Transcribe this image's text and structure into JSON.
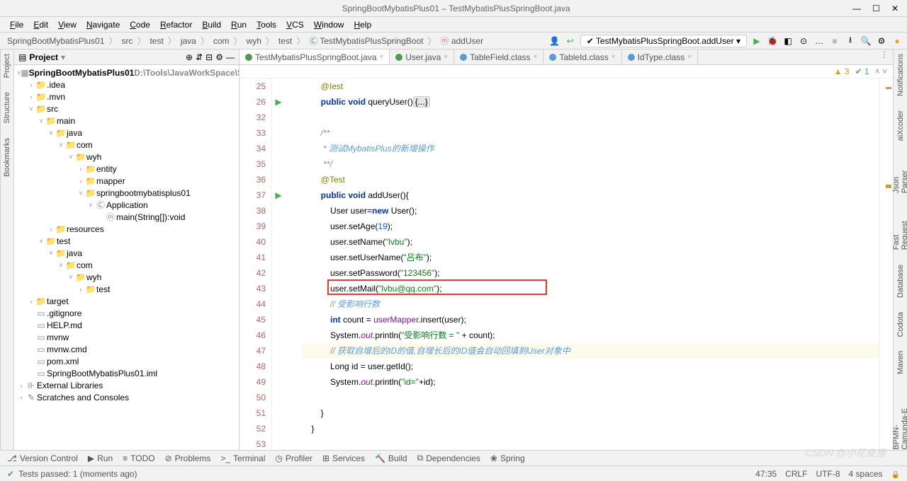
{
  "title": "SpringBootMybatisPlus01 – TestMybatisPlusSpringBoot.java",
  "menu": [
    "File",
    "Edit",
    "View",
    "Navigate",
    "Code",
    "Refactor",
    "Build",
    "Run",
    "Tools",
    "VCS",
    "Window",
    "Help"
  ],
  "breadcrumb": [
    "SpringBootMybatisPlus01",
    "src",
    "test",
    "java",
    "com",
    "wyh",
    "test",
    "TestMybatisPlusSpringBoot",
    "addUser"
  ],
  "run_config": "TestMybatisPlusSpringBoot.addUser",
  "project_tool": "Project",
  "tree": [
    {
      "d": 0,
      "a": "v",
      "i": "mod",
      "t": "SpringBootMybatisPlus01",
      "suffix": "  D:\\Tools\\JavaWorkSpace\\Sprin",
      "bold": true
    },
    {
      "d": 1,
      "a": ">",
      "i": "fol",
      "t": ".idea"
    },
    {
      "d": 1,
      "a": ">",
      "i": "fol",
      "t": ".mvn"
    },
    {
      "d": 1,
      "a": "v",
      "i": "folb",
      "t": "src"
    },
    {
      "d": 2,
      "a": "v",
      "i": "folb",
      "t": "main"
    },
    {
      "d": 3,
      "a": "v",
      "i": "folb",
      "t": "java"
    },
    {
      "d": 4,
      "a": "v",
      "i": "fol",
      "t": "com"
    },
    {
      "d": 5,
      "a": "v",
      "i": "fol",
      "t": "wyh"
    },
    {
      "d": 6,
      "a": ">",
      "i": "fol",
      "t": "entity"
    },
    {
      "d": 6,
      "a": ">",
      "i": "fol",
      "t": "mapper"
    },
    {
      "d": 6,
      "a": "v",
      "i": "fol",
      "t": "springbootmybatisplus01"
    },
    {
      "d": 7,
      "a": "v",
      "i": "cls",
      "t": "Application"
    },
    {
      "d": 8,
      "a": " ",
      "i": "m",
      "t": "main(String[]):void"
    },
    {
      "d": 3,
      "a": ">",
      "i": "folb",
      "t": "resources"
    },
    {
      "d": 2,
      "a": "v",
      "i": "folb",
      "t": "test"
    },
    {
      "d": 3,
      "a": "v",
      "i": "folb",
      "t": "java"
    },
    {
      "d": 4,
      "a": "v",
      "i": "fol",
      "t": "com"
    },
    {
      "d": 5,
      "a": "v",
      "i": "fol",
      "t": "wyh"
    },
    {
      "d": 6,
      "a": ">",
      "i": "fol",
      "t": "test"
    },
    {
      "d": 1,
      "a": ">",
      "i": "folo",
      "t": "target"
    },
    {
      "d": 1,
      "a": " ",
      "i": "f",
      "t": ".gitignore"
    },
    {
      "d": 1,
      "a": " ",
      "i": "f",
      "t": "HELP.md"
    },
    {
      "d": 1,
      "a": " ",
      "i": "f",
      "t": "mvnw"
    },
    {
      "d": 1,
      "a": " ",
      "i": "f",
      "t": "mvnw.cmd"
    },
    {
      "d": 1,
      "a": " ",
      "i": "f",
      "t": "pom.xml"
    },
    {
      "d": 1,
      "a": " ",
      "i": "f",
      "t": "SpringBootMybatisPlus01.iml"
    },
    {
      "d": 0,
      "a": ">",
      "i": "lib",
      "t": "External Libraries"
    },
    {
      "d": 0,
      "a": ">",
      "i": "scr",
      "t": "Scratches and Consoles"
    }
  ],
  "tabs": [
    {
      "label": "TestMybatisPlusSpringBoot.java",
      "active": true,
      "dot": "c"
    },
    {
      "label": "User.java",
      "dot": "c"
    },
    {
      "label": "TableField.class",
      "dot": "j"
    },
    {
      "label": "TableId.class",
      "dot": "j"
    },
    {
      "label": "IdType.class",
      "dot": "j"
    }
  ],
  "inspection": {
    "warn": "3",
    "ok": "1"
  },
  "code_lines": [
    {
      "n": "25",
      "html": "        <span class='ann'>@Iest</span>"
    },
    {
      "n": "26",
      "mark": "▶",
      "html": "        <span class='kw'>public</span> <span class='kw'>void</span> queryUser()<span class='fold'>{...}</span>"
    },
    {
      "n": "32",
      "html": ""
    },
    {
      "n": "33",
      "html": "        <span class='cmt-doc'>/**</span>"
    },
    {
      "n": "34",
      "html": "        <span class='cmt-doc'> * <span class='zh'>测试MybatisPlus的新增操作</span></span>"
    },
    {
      "n": "35",
      "html": "        <span class='cmt-doc'> **/</span>"
    },
    {
      "n": "36",
      "html": "        <span class='ann'>@Test</span>"
    },
    {
      "n": "37",
      "mark": "▶",
      "html": "        <span class='kw'>public</span> <span class='kw'>void</span> addUser(){"
    },
    {
      "n": "38",
      "html": "            User user=<span class='kw'>new</span> User();"
    },
    {
      "n": "39",
      "html": "            user.setAge(<span class='num'>19</span>);"
    },
    {
      "n": "40",
      "html": "            user.setName(<span class='str'>\"lvbu\"</span>);"
    },
    {
      "n": "41",
      "html": "            user.setUserName(<span class='str'>\"吕布\"</span>);"
    },
    {
      "n": "42",
      "html": "            user.setPassword(<span class='str'>\"123456\"</span>);"
    },
    {
      "n": "43",
      "html": "            user.setMail(<span class='str'>\"lvbu@qq.com\"</span>);"
    },
    {
      "n": "44",
      "html": "            <span class='cmt-line'>// <span class='zh'>受影响行数</span></span>"
    },
    {
      "n": "45",
      "html": "            <span class='kw'>int</span> count = <span class='fld'>userMapper</span>.insert(user);"
    },
    {
      "n": "46",
      "html": "            System.<span class='fld ital'>out</span>.println(<span class='str'>\"受影响行数 = \"</span> + count);"
    },
    {
      "n": "47",
      "hl": true,
      "html": "            <span class='cmt-line'>// <span class='zh'>获取自增后的ID的值,自增长后的ID值会自动回填到User对象中</span></span>"
    },
    {
      "n": "48",
      "html": "            Long id = user.getId();"
    },
    {
      "n": "49",
      "html": "            System.<span class='fld ital'>out</span>.println(<span class='str'>\"id=\"</span>+id);"
    },
    {
      "n": "50",
      "html": ""
    },
    {
      "n": "51",
      "html": "        }"
    },
    {
      "n": "52",
      "html": "    }"
    },
    {
      "n": "53",
      "html": ""
    }
  ],
  "red_box_line": "43",
  "bottom_tools": [
    "Version Control",
    "Run",
    "TODO",
    "Problems",
    "Terminal",
    "Profiler",
    "Services",
    "Build",
    "Dependencies",
    "Spring"
  ],
  "status": {
    "left": "Tests passed: 1 (moments ago)",
    "pos": "47:35",
    "eol": "CRLF",
    "enc": "UTF-8",
    "indent": "4 spaces"
  },
  "right_tools": [
    "Notifications",
    "aiXcoder",
    "Json Parser",
    "Fast Request",
    "Database",
    "Codota",
    "Maven",
    "BPMN-Camunda-E"
  ],
  "left_tools": [
    "Project",
    "Structure",
    "Bookmarks"
  ],
  "watermark": "CSDN @小花皮猪"
}
